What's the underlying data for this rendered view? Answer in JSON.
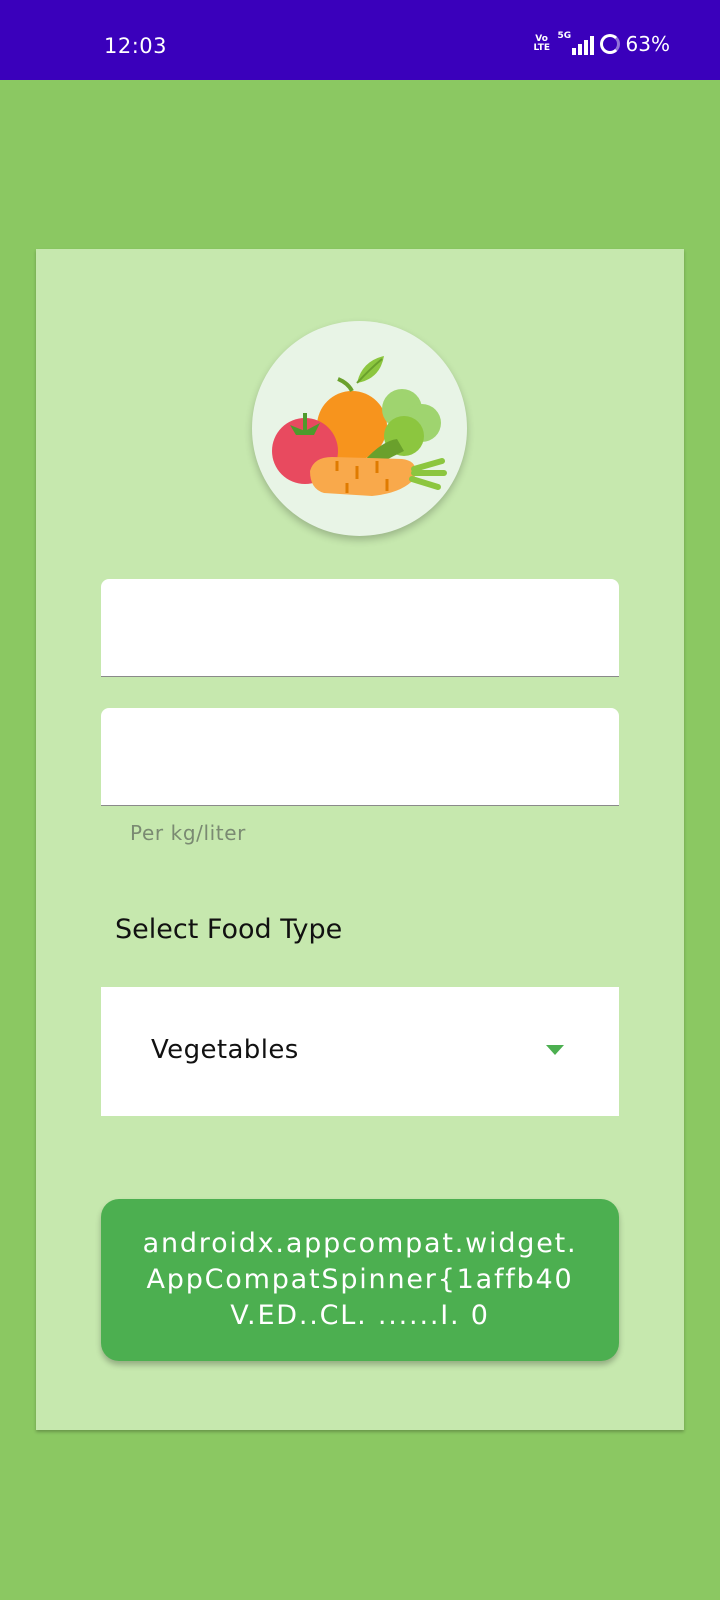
{
  "status_bar": {
    "time": "12:03",
    "volte_top": "Vo",
    "volte_bottom": "LTE",
    "network": "5G",
    "battery": "63%"
  },
  "logo": {
    "icon": "vegetables-icon"
  },
  "form": {
    "field_1_value": "",
    "field_2_value": "",
    "field_2_helper": "Per kg/liter",
    "food_type_label": "Select Food Type",
    "food_type_selected": "Vegetables"
  },
  "submit_button": {
    "line_1": "androidx.appcompat.widget.",
    "line_2": "AppCompatSpinner{1affb40",
    "line_3": "V.ED..CL. ......I. 0"
  },
  "colors": {
    "status_bar": "#3a00bb",
    "background": "#8bc862",
    "card": "#c6e8ae",
    "accent": "#4caf50"
  }
}
